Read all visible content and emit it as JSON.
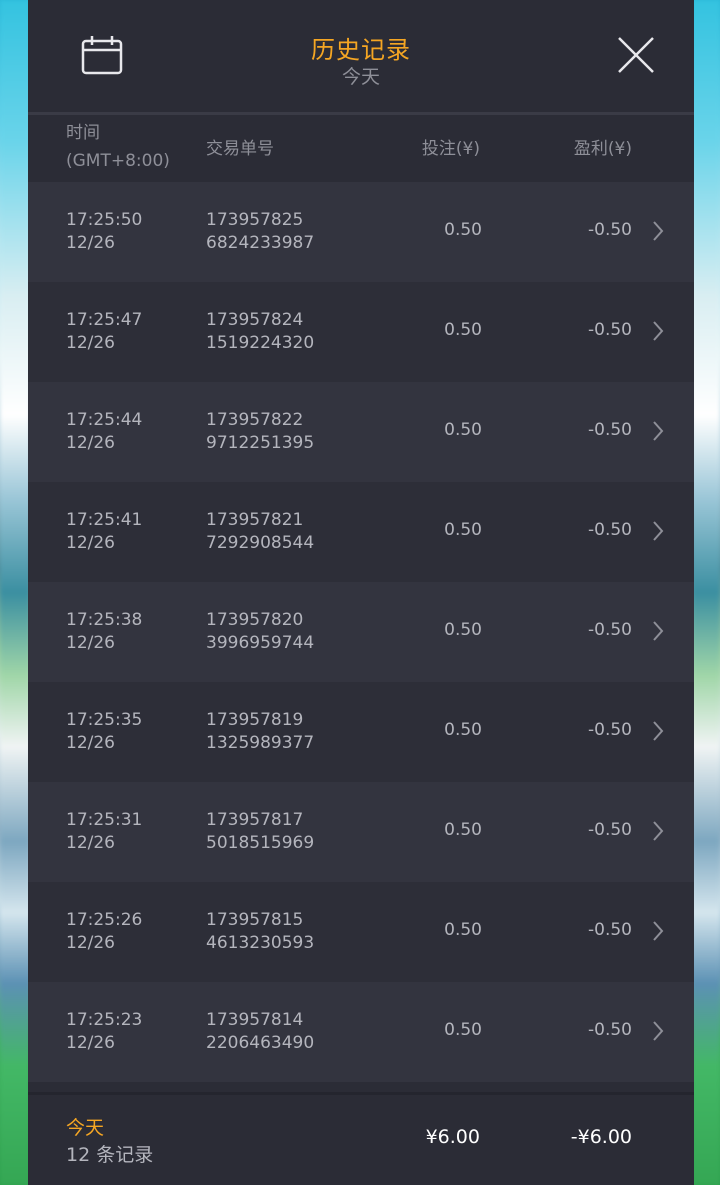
{
  "header": {
    "title": "历史记录",
    "subtitle": "今天"
  },
  "columns": {
    "time_line1": "时间",
    "time_line2": "(GMT+8:00)",
    "order": "交易单号",
    "bet": "投注(¥)",
    "profit": "盈利(¥)"
  },
  "rows": [
    {
      "time": "17:25:50",
      "date": "12/26",
      "order_a": "173957825",
      "order_b": "6824233987",
      "bet": "0.50",
      "profit": "-0.50"
    },
    {
      "time": "17:25:47",
      "date": "12/26",
      "order_a": "173957824",
      "order_b": "1519224320",
      "bet": "0.50",
      "profit": "-0.50"
    },
    {
      "time": "17:25:44",
      "date": "12/26",
      "order_a": "173957822",
      "order_b": "9712251395",
      "bet": "0.50",
      "profit": "-0.50"
    },
    {
      "time": "17:25:41",
      "date": "12/26",
      "order_a": "173957821",
      "order_b": "7292908544",
      "bet": "0.50",
      "profit": "-0.50"
    },
    {
      "time": "17:25:38",
      "date": "12/26",
      "order_a": "173957820",
      "order_b": "3996959744",
      "bet": "0.50",
      "profit": "-0.50"
    },
    {
      "time": "17:25:35",
      "date": "12/26",
      "order_a": "173957819",
      "order_b": "1325989377",
      "bet": "0.50",
      "profit": "-0.50"
    },
    {
      "time": "17:25:31",
      "date": "12/26",
      "order_a": "173957817",
      "order_b": "5018515969",
      "bet": "0.50",
      "profit": "-0.50"
    },
    {
      "time": "17:25:26",
      "date": "12/26",
      "order_a": "173957815",
      "order_b": "4613230593",
      "bet": "0.50",
      "profit": "-0.50"
    },
    {
      "time": "17:25:23",
      "date": "12/26",
      "order_a": "173957814",
      "order_b": "2206463490",
      "bet": "0.50",
      "profit": "-0.50"
    }
  ],
  "footer": {
    "label": "今天",
    "count": "12 条记录",
    "total_bet": "¥6.00",
    "total_profit": "-¥6.00"
  },
  "icons": {
    "calendar": "calendar-icon",
    "close": "close-icon",
    "chevron": "chevron-right-icon"
  },
  "colors": {
    "accent": "#f5a623",
    "panel_bg": "#2b2c36",
    "row_odd": "#33343f",
    "row_even": "#2d2e38"
  }
}
